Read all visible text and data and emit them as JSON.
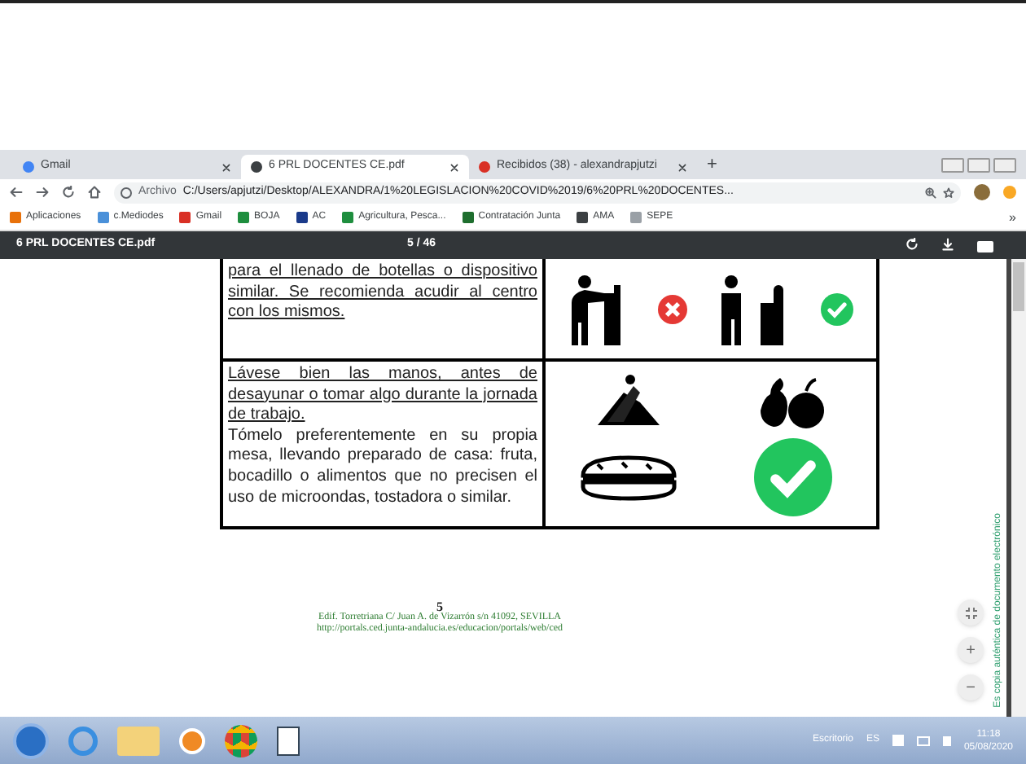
{
  "tabs": [
    {
      "label": "Gmail",
      "selected": false,
      "color": "#4285f4"
    },
    {
      "label": "6 PRL DOCENTES CE.pdf",
      "selected": true,
      "color": "#3c4043"
    },
    {
      "label": "Recibidos (38) - alexandrapjutzi",
      "selected": false,
      "color": "#d93025"
    }
  ],
  "new_tab": "+",
  "address": {
    "scheme": "Archivo",
    "url": "C:/Users/apjutzi/Desktop/ALEXANDRA/1%20LEGISLACION%20COVID%2019/6%20PRL%20DOCENTES..."
  },
  "bookmarks": [
    {
      "label": "Aplicaciones",
      "color": "#e8710a"
    },
    {
      "label": "c.Mediodes",
      "color": "#4a90d9"
    },
    {
      "label": "Gmail",
      "color": "#d93025"
    },
    {
      "label": "BOJA",
      "color": "#1e8e3e"
    },
    {
      "label": "AC",
      "color": "#1a3a8a"
    },
    {
      "label": "Agricultura, Pesca...",
      "color": "#1e8e3e"
    },
    {
      "label": "Contratación Junta",
      "color": "#1e6e2e"
    },
    {
      "label": "AMA",
      "color": "#3c4043"
    },
    {
      "label": "SEPE",
      "color": "#9aa0a6"
    }
  ],
  "bookmarks_overflow": "»",
  "pdf_toolbar": {
    "title": "6 PRL DOCENTES CE.pdf",
    "page": "5 / 46"
  },
  "table": {
    "rows": [
      {
        "kind": "fountain",
        "paragraphs": [
          {
            "text": "para el llenado de botellas o dispositivo similar. Se recomienda acudir al centro con los mismos.",
            "underlined": true
          }
        ]
      },
      {
        "kind": "food",
        "paragraphs": [
          {
            "text": "Lávese bien las manos, antes de desayunar o tomar algo durante la jornada de trabajo.",
            "underlined": true
          },
          {
            "text": "Tómelo preferentemente en su propia mesa, llevando preparado de casa: fruta, bocadillo o alimentos que no precisen el uso de microondas, tostadora o similar.",
            "underlined": false
          }
        ]
      }
    ]
  },
  "footer": {
    "page_number": "5",
    "address": "Edif. Torretriana C/ Juan A. de Vizarrón s/n 41092, SEVILLA",
    "url": "http://portals.ced.junta-andalucia.es/educacion/portals/web/ced"
  },
  "side_note": "Es copia auténtica de documento electrónico",
  "zoom": {
    "in": "+",
    "out": "−"
  },
  "taskbar": {
    "desktop": "Escritorio",
    "language": "ES",
    "time": "11:18",
    "date": "05/08/2020"
  }
}
